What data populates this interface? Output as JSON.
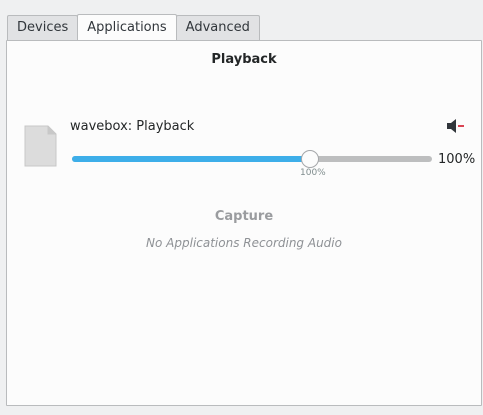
{
  "tabs": [
    {
      "label": "Devices",
      "active": false
    },
    {
      "label": "Applications",
      "active": true
    },
    {
      "label": "Advanced",
      "active": false
    }
  ],
  "playback": {
    "title": "Playback",
    "stream": {
      "name": "wavebox: Playback",
      "icon": "document-icon",
      "mute_icon": "speaker-muted-icon",
      "volume_fraction": 0.66,
      "volume_text": "100%",
      "tick_label": "100%"
    }
  },
  "capture": {
    "title": "Capture",
    "empty_message": "No Applications Recording Audio"
  },
  "colors": {
    "accent": "#3daee9",
    "window_bg": "#eff0f1",
    "panel_bg": "#fcfcfc",
    "mute_indicator": "#da4453"
  }
}
